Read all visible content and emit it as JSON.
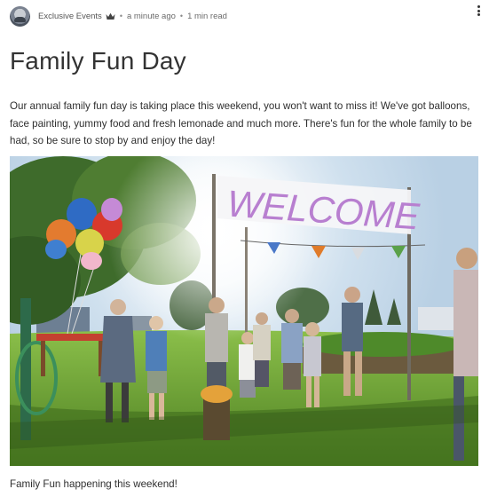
{
  "post": {
    "author": "Exclusive Events",
    "time_ago": "a minute ago",
    "read_time": "1 min read",
    "title": "Family Fun Day",
    "body": "Our annual family fun day is taking place this weekend, you won't want to miss it! We've got balloons, face painting, yummy food and fresh lemonade and much more. There's fun for the   whole family to be had, so be sure to stop by and enjoy the day!",
    "caption": "Family Fun happening this weekend!",
    "banner_text": "WELCOME"
  },
  "icons": {
    "avatar": "avatar",
    "crown": "crown-icon",
    "more": "more-options-icon"
  },
  "colors": {
    "text": "#2e2e2e",
    "meta": "#6b6b6b",
    "banner_letters": "#b87fd0"
  }
}
